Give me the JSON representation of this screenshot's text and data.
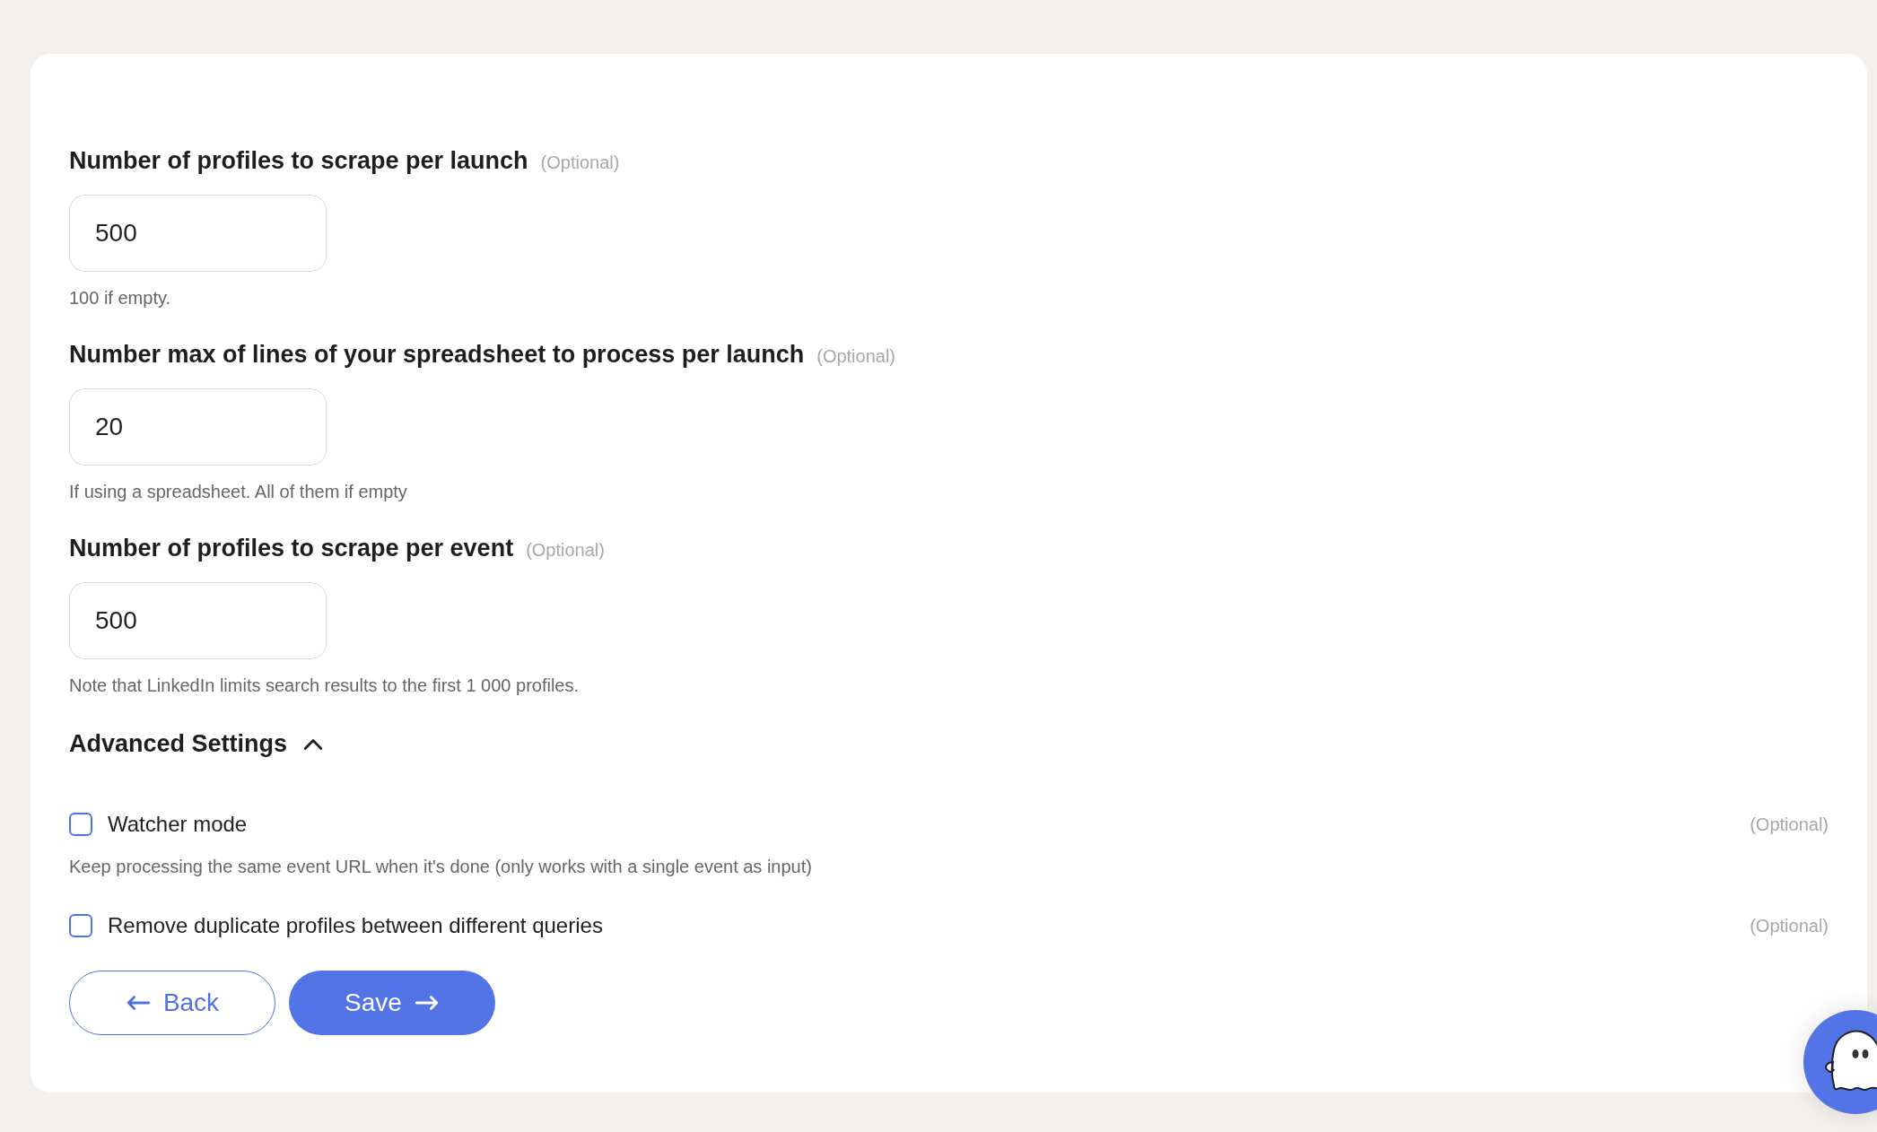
{
  "fields": [
    {
      "label": "Number of profiles to scrape per launch",
      "optional": "(Optional)",
      "value": "500",
      "hint": "100 if empty."
    },
    {
      "label": "Number max of lines of your spreadsheet to process per launch",
      "optional": "(Optional)",
      "value": "20",
      "hint": "If using a spreadsheet. All of them if empty"
    },
    {
      "label": "Number of profiles to scrape per event",
      "optional": "(Optional)",
      "value": "500",
      "hint": "Note that LinkedIn limits search results to the first 1 000 profiles."
    }
  ],
  "advanced": {
    "title": "Advanced Settings",
    "expanded": true,
    "options": [
      {
        "label": "Watcher mode",
        "checked": false,
        "optional": "(Optional)",
        "hint": "Keep processing the same event URL when it's done (only works with a single event as input)"
      },
      {
        "label": "Remove duplicate profiles between different queries",
        "checked": false,
        "optional": "(Optional)"
      }
    ]
  },
  "buttons": [
    {
      "label": "Back",
      "kind": "back"
    },
    {
      "label": "Save",
      "kind": "save"
    }
  ]
}
